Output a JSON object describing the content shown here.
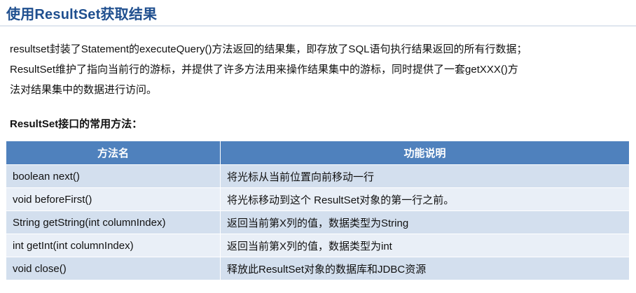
{
  "title": "使用ResultSet获取结果",
  "description": {
    "lines": [
      "resultset封装了Statement的executeQuery()方法返回的结果集，即存放了SQL语句执行结果返回的所有行数据；",
      "ResultSet维护了指向当前行的游标，并提供了许多方法用来操作结果集中的游标，同时提供了一套getXXX()方",
      "法对结果集中的数据进行访问。"
    ]
  },
  "subheading": "ResultSet接口的常用方法：",
  "table": {
    "headers": [
      "方法名",
      "功能说明"
    ],
    "rows": [
      [
        "boolean next()",
        "将光标从当前位置向前移动一行"
      ],
      [
        "void beforeFirst()",
        "将光标移动到这个 ResultSet对象的第一行之前。"
      ],
      [
        "String getString(int columnIndex)",
        "返回当前第X列的值，数据类型为String"
      ],
      [
        "int getInt(int columnIndex)",
        "返回当前第X列的值，数据类型为int"
      ],
      [
        "void close()",
        "释放此ResultSet对象的数据库和JDBC资源"
      ]
    ]
  },
  "colors": {
    "title": "#1f4f8f",
    "header_bg": "#4f81bd",
    "row_odd": "#d3dfee",
    "row_even": "#e9eff7"
  }
}
